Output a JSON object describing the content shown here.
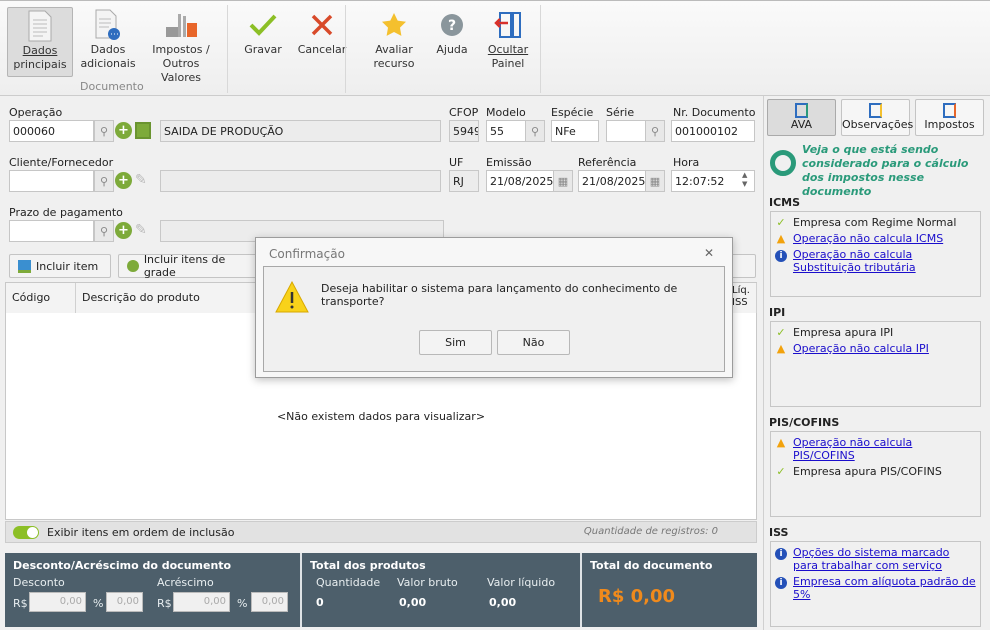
{
  "ribbon": {
    "buttons": [
      {
        "label1": "Dados",
        "label2": "principais",
        "active": true
      },
      {
        "label1": "Dados",
        "label2": "adicionais"
      },
      {
        "label1": "Impostos /",
        "label2": "Outros Valores"
      },
      {
        "label1": "Gravar",
        "label2": ""
      },
      {
        "label1": "Cancelar",
        "label2": ""
      },
      {
        "label1": "Avaliar",
        "label2": "recurso"
      },
      {
        "label1": "Ajuda",
        "label2": ""
      },
      {
        "label1": "Ocultar",
        "label2": "Painel"
      }
    ],
    "group_documento": "Documento"
  },
  "form": {
    "operacao_label": "Operação",
    "operacao_code": "000060",
    "operacao_desc": "SAIDA DE PRODUÇÃO",
    "cfop_label": "CFOP",
    "cfop": "5949",
    "modelo_label": "Modelo",
    "modelo": "55",
    "especie_label": "Espécie",
    "especie": "NFe",
    "serie_label": "Série",
    "serie": "",
    "nrdoc_label": "Nr. Documento",
    "nrdoc": "001000102",
    "cliente_label": "Cliente/Fornecedor",
    "uf_label": "UF",
    "uf": "RJ",
    "emissao_label": "Emissão",
    "emissao": "21/08/2025",
    "referencia_label": "Referência",
    "referencia": "21/08/2025",
    "hora_label": "Hora",
    "hora": "12:07:52",
    "prazo_label": "Prazo de pagamento"
  },
  "actions": {
    "incluir_item": "Incluir item",
    "incluir_grade": "Incluir itens de grade"
  },
  "grid": {
    "columns": [
      "Código",
      "Descrição do produto",
      "Líq.",
      "ISS"
    ],
    "empty": "<Não existem dados para visualizar>",
    "toggle_label": "Exibir itens em ordem de inclusão",
    "count": "Quantidade de registros: 0"
  },
  "totals": {
    "desc_title": "Desconto/Acréscimo do documento",
    "desconto": "Desconto",
    "acrescimo": "Acréscimo",
    "rs": "R$",
    "pct": "%",
    "desc_rs": "0,00",
    "desc_pct": "0,00",
    "acr_rs": "0,00",
    "acr_pct": "0,00",
    "prod_title": "Total dos produtos",
    "quantidade": "Quantidade",
    "valor_bruto": "Valor bruto",
    "valor_liquido": "Valor líquido",
    "q_val": "0",
    "vb_val": "0,00",
    "vl_val": "0,00",
    "doc_title": "Total do documento",
    "doc_val": "R$ 0,00"
  },
  "panel": {
    "tabs": [
      "AVA",
      "Observações",
      "Impostos"
    ],
    "intro": "Veja o que está sendo considerado para o cálculo dos impostos nesse documento",
    "sections": [
      {
        "title": "ICMS",
        "items": [
          {
            "type": "ok",
            "text": "Empresa com Regime Normal"
          },
          {
            "type": "warn",
            "text": "Operação não calcula ICMS"
          },
          {
            "type": "info",
            "text": "Operação não calcula Substituição tributária"
          }
        ]
      },
      {
        "title": "IPI",
        "items": [
          {
            "type": "ok",
            "text": "Empresa apura IPI"
          },
          {
            "type": "warn",
            "text": "Operação não calcula IPI"
          }
        ]
      },
      {
        "title": "PIS/COFINS",
        "items": [
          {
            "type": "warn",
            "text": "Operação não calcula PIS/COFINS"
          },
          {
            "type": "ok",
            "text": "Empresa apura PIS/COFINS"
          }
        ]
      },
      {
        "title": "ISS",
        "items": [
          {
            "type": "info",
            "text": "Opções do sistema marcado para trabalhar com serviço"
          },
          {
            "type": "info",
            "text": "Empresa com alíquota padrão de 5%"
          }
        ]
      }
    ]
  },
  "dialog": {
    "title": "Confirmação",
    "message": "Deseja habilitar o sistema para lançamento do conhecimento de transporte?",
    "yes": "Sim",
    "no": "Não"
  },
  "colors": {
    "accent_green": "#7daa3a",
    "bottom_bar": "#4d5f6b",
    "total_orange": "#f08a1c",
    "ava_teal": "#2a9a7a"
  }
}
